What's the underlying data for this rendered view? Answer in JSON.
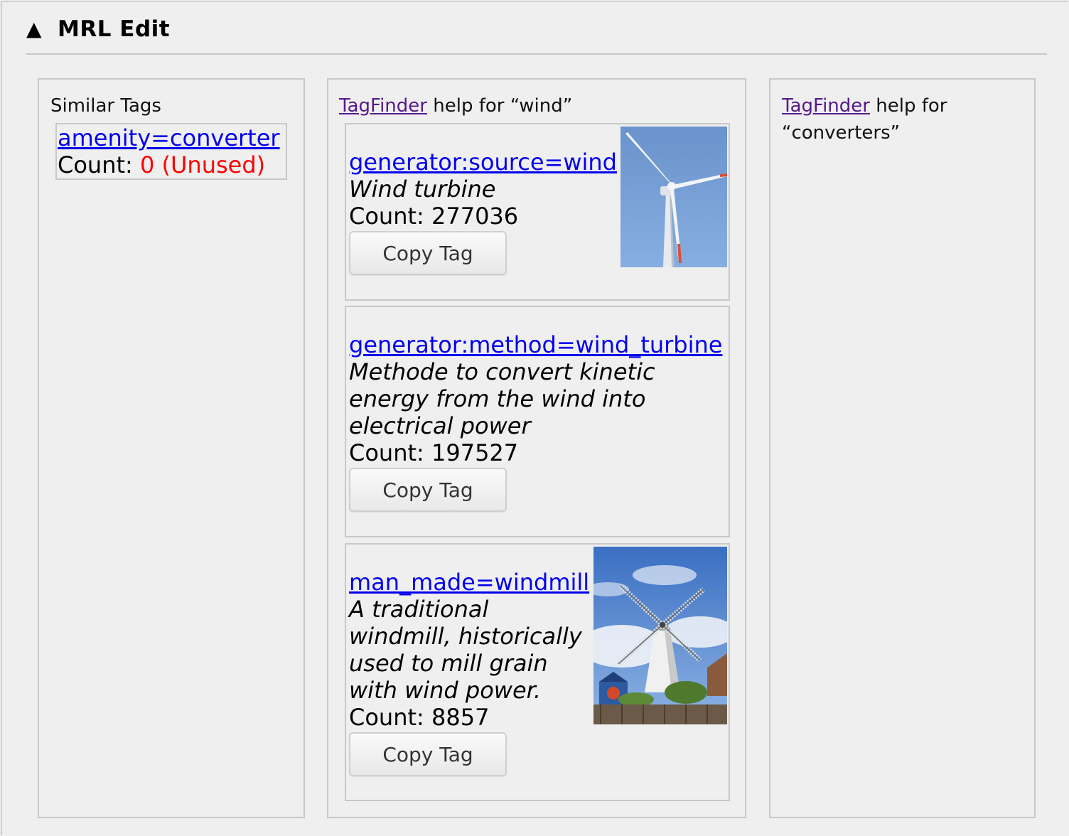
{
  "header": {
    "toggle_icon": "▲",
    "title": "MRL Edit"
  },
  "similar_tags": {
    "heading": "Similar Tags",
    "items": [
      {
        "tag": "amenity=converter",
        "count_label": "Count:",
        "count_value": "0 (Unused)"
      }
    ]
  },
  "tagfinder_wind": {
    "link_text": "TagFinder",
    "heading_rest": " help for “wind”",
    "results": [
      {
        "tag": "generator:source=wind",
        "description": "Wind turbine",
        "count": "Count: 277036",
        "button": "Copy Tag",
        "image": "wind-turbine-photo"
      },
      {
        "tag": "generator:method=wind_turbine",
        "description": "Methode to convert kinetic energy from the wind into electrical power",
        "count": "Count: 197527",
        "button": "Copy Tag",
        "image": null
      },
      {
        "tag": "man_made=windmill",
        "description": "A traditional windmill, historically used to mill grain with wind power.",
        "count": "Count: 8857",
        "button": "Copy Tag",
        "image": "windmill-photo"
      }
    ]
  },
  "tagfinder_converters": {
    "link_text": "TagFinder",
    "heading_rest": " help for “converters”"
  },
  "colors": {
    "link": "#0000ee",
    "visited_link": "#551a8b",
    "unused": "#ff0000",
    "background": "#efefef",
    "border": "#c8c8c8"
  }
}
